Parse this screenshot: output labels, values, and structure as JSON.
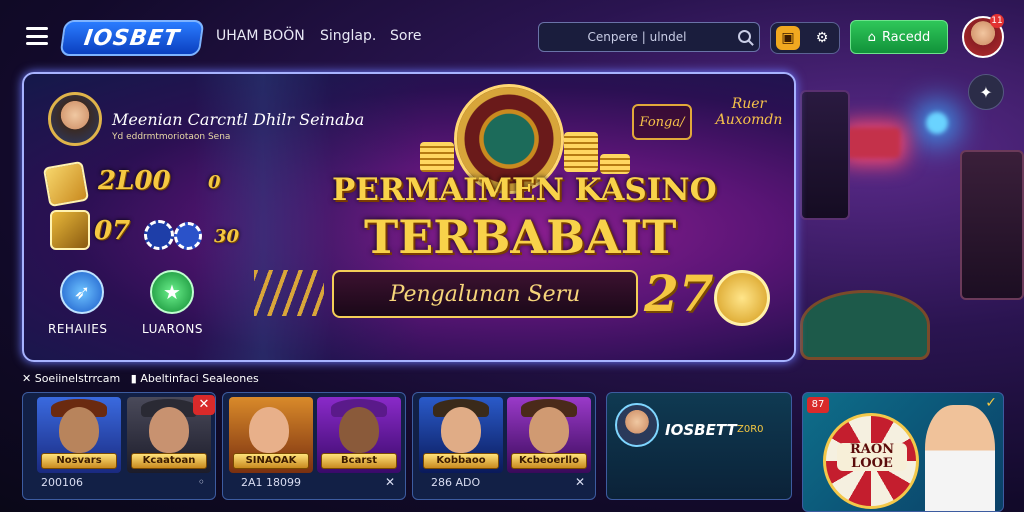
{
  "header": {
    "logo": "IOSBET",
    "nav": [
      "UHAM BOÖN",
      "Singlap.",
      "Sore"
    ],
    "search_placeholder": "Cenpere | ulndel",
    "login_label": "Racedd",
    "notification_count": "11"
  },
  "hero": {
    "username": "Meenian Carcntl Dhilr Seinaba",
    "user_sub": "Yd eddrmtmoriotaon Sena",
    "stat1": "2L00",
    "stat1_suffix": "0",
    "stat2": "07",
    "stat2_suffix": "30",
    "btn1_label": "REHAIIES",
    "btn2_label": "LUARONS",
    "title_line1": "PERMAIMEN KASINO",
    "title_line2": "TERBABAIT",
    "subtitle": "Pengalunan Seru",
    "sign_left": "Fonga/",
    "sign_right_1": "Ruer",
    "sign_right_2": "Auxomdn",
    "big_number": "27"
  },
  "section": {
    "label1": "Soeiinelstrrcam",
    "label2": "Abeltinfaci Sealeones"
  },
  "games": [
    {
      "name": "Nosvars",
      "meta": "200106"
    },
    {
      "name": "Kcaatoan"
    },
    {
      "name": "SINAOAK",
      "meta": "2A1 18099"
    },
    {
      "name": "Bcarst"
    },
    {
      "name": "Kobbaoo",
      "meta": "286 ADO"
    },
    {
      "name": "Kcbeoerllo"
    }
  ],
  "promo": {
    "title": "IOSBETT",
    "suffix": "Z0R0"
  },
  "card_promo": {
    "tag": "87",
    "wheel_label": "RAON LOOE"
  }
}
